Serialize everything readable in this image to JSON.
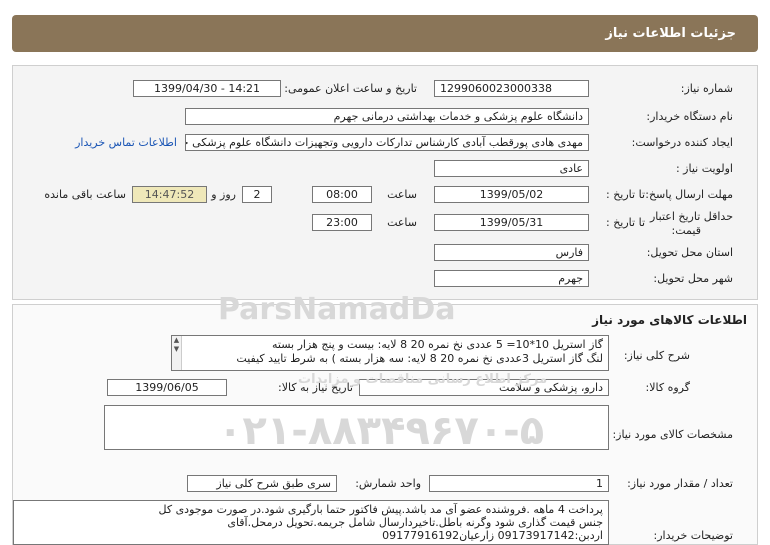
{
  "header": {
    "title": "جزئیات اطلاعات نیاز"
  },
  "fields": {
    "need_number_label": "شماره نیاز:",
    "need_number": "1299060023000338",
    "announce_label": "تاریخ و ساعت اعلان عمومی:",
    "announce_value": "1399/04/30 - 14:21",
    "buyer_label": "نام دستگاه خریدار:",
    "buyer": "دانشگاه علوم پزشکی و خدمات بهداشتی درمانی جهرم",
    "requester_label": "ایجاد کننده درخواست:",
    "requester": "مهدی هادی پورقطب آبادی کارشناس تدارکات دارویی وتجهیزات دانشگاه علوم پزشکی جهرم",
    "contact_link": "اطلاعات تماس خریدار",
    "priority_label": "اولویت نیاز :",
    "priority": "عادی",
    "deadline_label": "مهلت ارسال پاسخ:",
    "to_date_label": "تا تاریخ :",
    "deadline_date": "1399/05/02",
    "time_label": "ساعت",
    "deadline_time": "08:00",
    "days": "2",
    "days_label": "روز و",
    "countdown": "14:47:52",
    "remaining_label": "ساعت باقی مانده",
    "validity_label_1": "حداقل تاریخ اعتبار",
    "validity_label_2": "قیمت:",
    "validity_to_label": "تا تاریخ :",
    "validity_date": "1399/05/31",
    "validity_time_label": "ساعت",
    "validity_time": "23:00",
    "province_label": "استان محل تحویل:",
    "province": "فارس",
    "city_label": "شهر محل تحویل:",
    "city": "جهرم"
  },
  "goods": {
    "section_title": "اطلاعات کالاهای مورد نیاز",
    "desc_label": "شرح کلی نیاز:",
    "desc_line1": "گاز استریل 10*10= 5 عددی نخ نمره 20 8 لایه: بیست و پنج هزار بسته",
    "desc_line2": "لنگ گاز استریل  3عددی نخ نمره 20 8 لایه: سه هزار بسته )  به شرط تایید کیفیت",
    "group_label": "گروه کالا:",
    "group": "دارو، پزشکی و سلامت",
    "need_date_label": "تاریخ نیاز به کالا:",
    "need_date": "1399/06/05",
    "spec_label": "مشخصات کالای مورد نیاز:",
    "qty_label": "تعداد / مقدار مورد نیاز:",
    "qty": "1",
    "unit_label": "واحد شمارش:",
    "unit": "سری طبق شرح کلی نیاز",
    "buyer_notes_label": "توضیحات خریدار:",
    "notes_line1": "پرداخت 4 ماهه .فروشنده عضو آی مد باشد.پیش فاکتور حتما بارگیری شود.در صورت موجودی کل",
    "notes_line2": "جنس قیمت گذاری شود وگرنه باطل.تاخیردارسال شامل جریمه.تحویل درمحل.آقای",
    "notes_line3": "اردبن:09173917142 زارعیان09177916192"
  },
  "watermark": {
    "brand": "ParsNamadDa",
    "subtitle": "مرکز اطلاع رسانی مناقصات و مزایدات",
    "phone": "۰۲۱-۸۸۳۴۹۶۷۰-۵"
  }
}
